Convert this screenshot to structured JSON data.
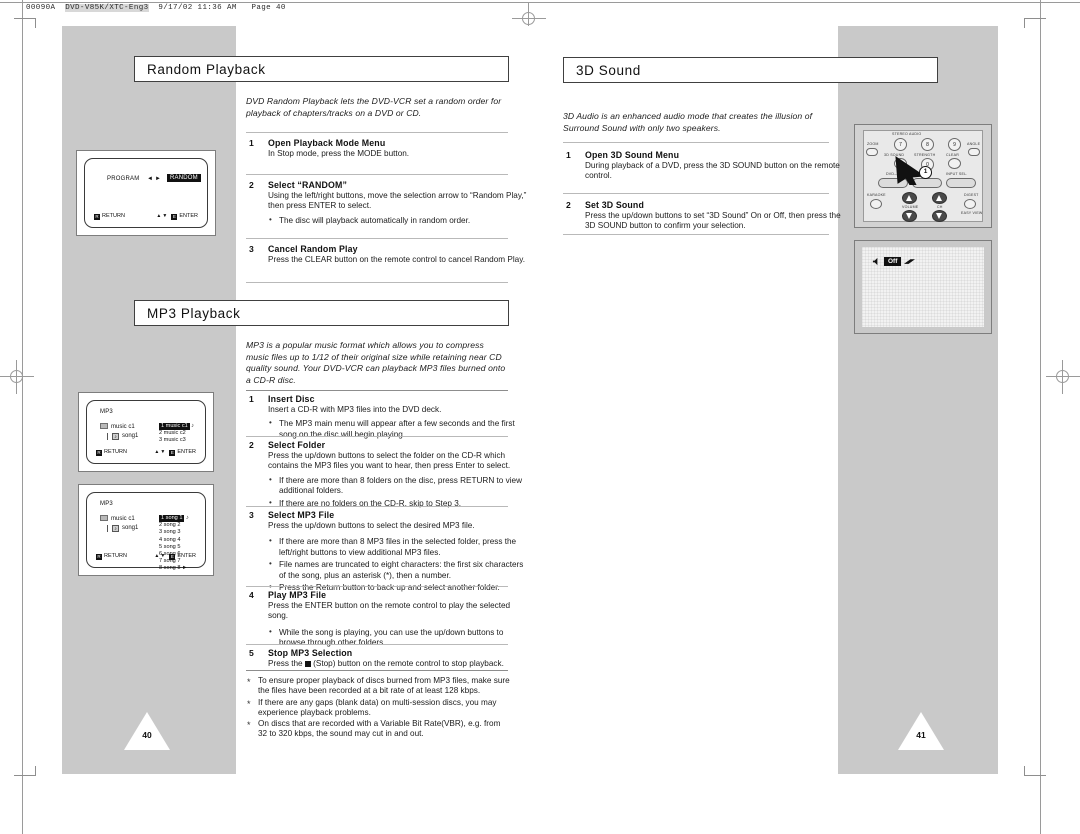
{
  "prepress": {
    "job": "00090A",
    "file": "DVD-V85K/XTC-Eng3",
    "stamp": "9/17/02 11:36 AM",
    "page": "Page 40"
  },
  "left_page": {
    "number": "40",
    "sections": [
      {
        "title": "Random Playback",
        "intro": "DVD Random Playback lets the DVD-VCR set a random order for playback of chapters/tracks on a DVD or CD.",
        "steps": [
          {
            "num": "1",
            "head": "Open Playback Mode Menu",
            "body": "In Stop mode, press the MODE button.",
            "bullets": []
          },
          {
            "num": "2",
            "head": "Select “RANDOM”",
            "body": "Using the left/right buttons, move the selection arrow to “Random Play,” then press ENTER to select.",
            "bullets": [
              "The disc will playback automatically in random order."
            ]
          },
          {
            "num": "3",
            "head": "Cancel Random Play",
            "body": "Press the CLEAR button on the remote control to cancel Random Play.",
            "bullets": []
          }
        ]
      },
      {
        "title": "MP3 Playback",
        "intro": "MP3 is a popular music format which allows you to compress music files up to 1/12 of their original size while retaining near CD quality sound. Your DVD-VCR can playback MP3 files burned onto a CD-R disc.",
        "steps": [
          {
            "num": "1",
            "head": "Insert Disc",
            "body": "Insert a CD-R with MP3 files into the DVD deck.",
            "bullets": [
              "The MP3 main menu will appear after a few seconds and the first song on the disc will begin playing."
            ]
          },
          {
            "num": "2",
            "head": "Select Folder",
            "body": "Press the up/down buttons to select the folder on the CD-R which contains the MP3 files you want to hear, then press Enter to select.",
            "bullets": [
              "If there are more than 8 folders on the disc, press RETURN to view additional folders.",
              "If there are no folders on the CD-R, skip to Step 3."
            ]
          },
          {
            "num": "3",
            "head": "Select MP3 File",
            "body": "Press the up/down buttons to select the desired MP3 file.",
            "bullets": [
              "If there are more than 8 MP3 files in the selected folder, press the left/right buttons to view additional MP3 files.",
              "File names are truncated to eight characters: the first six characters of the song, plus an asterisk (*), then a number.",
              "Press the Return button to back up and select another folder."
            ]
          },
          {
            "num": "4",
            "head": "Play MP3 File",
            "body": "Press the ENTER button on the remote control to play the selected song.",
            "bullets": [
              "While the song is playing, you can use the up/down buttons to browse through other folders."
            ]
          },
          {
            "num": "5",
            "head": "Stop MP3 Selection",
            "body": "(Stop) button on the remote control to stop playback.",
            "body_prefix": "Press the",
            "bullets": []
          }
        ],
        "notes": [
          "To ensure proper playback of discs burned from MP3 files, make sure the files have been recorded at a bit rate of at least 128 kbps.",
          "If there are any gaps (blank data) on multi-session discs, you may experience playback problems.",
          "On discs that are recorded with a Variable Bit Rate(VBR), e.g. from 32 to 320 kbps, the sound may cut in and out."
        ]
      }
    ]
  },
  "right_page": {
    "number": "41",
    "section": {
      "title": "3D Sound",
      "intro": "3D Audio is an enhanced audio mode that creates the illusion of Surround Sound with only two speakers.",
      "steps": [
        {
          "num": "1",
          "head": "Open 3D Sound Menu",
          "body": "During playback of a DVD, press the 3D SOUND button on the remote control."
        },
        {
          "num": "2",
          "head": "Set 3D Sound",
          "body": "Press the up/down buttons to set “3D Sound” On or Off, then press the 3D SOUND button to confirm your selection."
        }
      ]
    }
  },
  "figures": {
    "random_osd": {
      "label_left": "PROGRAM",
      "arrows": "◄ ►",
      "label_right": "RANDOM",
      "foot_left": "RETURN",
      "foot_mid": "▲▼",
      "foot_right": "ENTER"
    },
    "mp3_folder_osd": {
      "heading": "MP3",
      "tree_root": "music c1",
      "tree_child": "song1",
      "files": [
        "1 music c1",
        "2 music c2",
        "3 music c3"
      ],
      "selected_index": 0,
      "foot_left": "RETURN",
      "foot_mid": "▲▼",
      "foot_right": "ENTER"
    },
    "mp3_file_osd": {
      "heading": "MP3",
      "tree_root": "music c1",
      "tree_child": "song1",
      "files": [
        "1 song 1",
        "2 song 2",
        "3 song 3",
        "4 song 4",
        "5 song 5",
        "6 song 6",
        "7 song 7",
        "8 song 8"
      ],
      "selected_index": 0,
      "foot_left": "RETURN",
      "foot_mid": "▲▼",
      "foot_right": "ENTER"
    },
    "remote": {
      "buttons": [
        "7",
        "8",
        "9",
        "0",
        "1"
      ],
      "labels": [
        "ZOOM",
        "3D SOUND",
        "STRENGTH",
        "CLEAR",
        "ANGLE",
        "DVD",
        "MENU",
        "INPUT SEL.",
        "KARAOKE",
        "VOLUME",
        "CH",
        "DIGEST",
        "EASY VIEW"
      ],
      "callout": "1"
    },
    "sound_osd": {
      "state": "Off"
    }
  }
}
